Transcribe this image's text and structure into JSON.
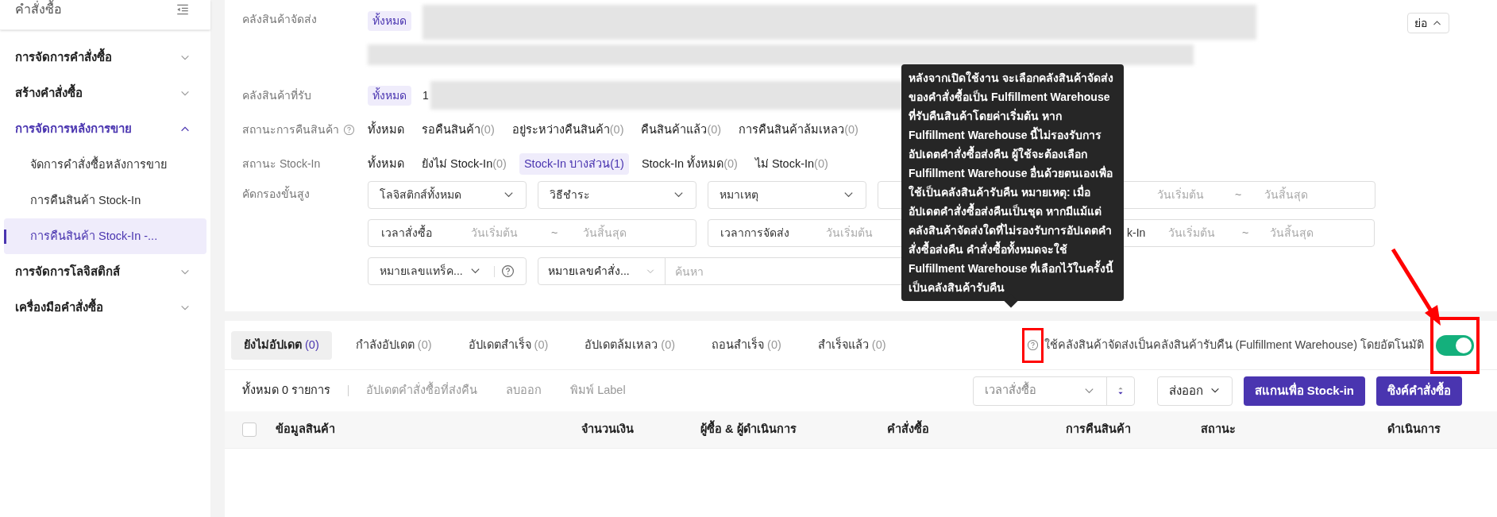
{
  "sidebar": {
    "title": "คำสั่งซื้อ",
    "items": [
      {
        "label": "การจัดการคำสั่งซื้อ",
        "expanded": false,
        "active": false
      },
      {
        "label": "สร้างคำสั่งซื้อ",
        "expanded": false,
        "active": false
      },
      {
        "label": "การจัดการหลังการขาย",
        "expanded": true,
        "active": true,
        "children": [
          {
            "label": "จัดการคำสั่งซื้อหลังการขาย",
            "selected": false
          },
          {
            "label": "การคืนสินค้า Stock-In",
            "selected": false
          },
          {
            "label": "การคืนสินค้า Stock-In -...",
            "selected": true
          }
        ]
      },
      {
        "label": "การจัดการโลจิสติกส์",
        "expanded": false,
        "active": false
      },
      {
        "label": "เครื่องมือคำสั่งซื้อ",
        "expanded": false,
        "active": false
      }
    ]
  },
  "filters": {
    "collapse_button": "ย่อ",
    "shipping_warehouse": {
      "label": "คลังสินค้าจัดส่ง",
      "all": "ทั้งหมด"
    },
    "receiving_warehouse": {
      "label": "คลังสินค้าที่รับ",
      "all": "ทั้งหมด",
      "first": "1"
    },
    "status_rows": [
      {
        "label": "สถานะการคืนสินค้า",
        "help": true,
        "options": [
          {
            "label": "ทั้งหมด",
            "selected": false
          },
          {
            "label": "รอคืนสินค้า",
            "count": "(0)",
            "selected": false
          },
          {
            "label": "อยู่ระหว่างคืนสินค้า",
            "count": "(0)",
            "selected": false
          },
          {
            "label": "คืนสินค้าแล้ว",
            "count": "(0)",
            "selected": false
          },
          {
            "label": "การคืนสินค้าล้มเหลว",
            "count": "(0)",
            "selected": false
          }
        ]
      },
      {
        "label": "สถานะ Stock-In",
        "options": [
          {
            "label": "ทั้งหมด",
            "selected": false
          },
          {
            "label": "ยังไม่ Stock-In",
            "count": "(0)",
            "selected": false
          },
          {
            "label": "Stock-In บางส่วน",
            "count": "(1)",
            "selected": true
          },
          {
            "label": "Stock-In ทั้งหมด",
            "count": "(0)",
            "selected": false
          },
          {
            "label": "ไม่ Stock-In",
            "count": "(0)",
            "selected": false
          }
        ]
      }
    ],
    "advanced_label": "คัดกรองขั้นสูง",
    "fields": [
      {
        "kind": "select",
        "text": "โลจิสติกส์ทั้งหมด"
      },
      {
        "kind": "select",
        "text": "วิธีชำระ"
      },
      {
        "kind": "select",
        "text": "หมาเหตุ"
      },
      {
        "kind": "blank"
      },
      {
        "kind": "range",
        "start": "วันเริ่มต้น",
        "sep": "~",
        "end": "วันสิ้นสุด"
      },
      {
        "kind": "range",
        "label": "เวลาสั่งซื้อ",
        "start": "วันเริ่มต้น",
        "sep": "~",
        "end": "วันสิ้นสุด"
      },
      {
        "kind": "range",
        "label": "เวลาการจัดส่ง",
        "start": "วันเริ่มต้น"
      },
      {
        "kind": "range",
        "label": "k-In",
        "start": "วันเริ่มต้น",
        "sep": "~",
        "end": "วันสิ้นสุด"
      },
      {
        "kind": "select_help",
        "text": "หมายเลขแทร็ค..."
      },
      {
        "kind": "search",
        "text": "หมายเลขคำสั่ง...",
        "placeholder": "ค้นหา"
      }
    ]
  },
  "tooltip": "หลังจากเปิดใช้งาน จะเลือกคลังสินค้าจัดส่งของคำสั่งซื้อเป็น Fulfillment Warehouse ที่รับคืนสินค้าโดยค่าเริ่มต้น หาก Fulfillment Warehouse นี้ไม่รองรับการอัปเดตคำสั่งซื้อส่งคืน ผู้ใช้จะต้องเลือก Fulfillment Warehouse อื่นด้วยตนเองเพื่อใช้เป็นคลังสินค้ารับคืน หมายเหตุ: เมื่ออัปเดตคำสั่งซื้อส่งคืนเป็นชุด หากมีแม้แต่คลังสินค้าจัดส่งใดที่ไม่รองรับการอัปเดตคำสั่งซื้อส่งคืน คำสั่งซื้อทั้งหมดจะใช้ Fulfillment Warehouse ที่เลือกไว้ในครั้งนี้เป็นคลังสินค้ารับคืน",
  "tabs": [
    {
      "label": "ยังไม่อัปเดต",
      "count": "(0)",
      "selected": true
    },
    {
      "label": "กำลังอัปเดต",
      "count": "(0)",
      "selected": false
    },
    {
      "label": "อัปเดตสำเร็จ",
      "count": "(0)",
      "selected": false
    },
    {
      "label": "อัปเดตล้มเหลว",
      "count": "(0)",
      "selected": false
    },
    {
      "label": "ถอนสำเร็จ",
      "count": "(0)",
      "selected": false
    },
    {
      "label": "สำเร็จแล้ว",
      "count": "(0)",
      "selected": false
    }
  ],
  "auto_fulfillment": {
    "label": "ใช้คลังสินค้าจัดส่งเป็นคลังสินค้ารับคืน (Fulfillment Warehouse) โดยอัตโนมัติ",
    "on": true
  },
  "toolbar": {
    "total": "ทั้งหมด 0 รายการ",
    "actions": [
      "อัปเดตคำสั่งซื้อที่ส่งคืน",
      "ลบออก",
      "พิมพ์ Label"
    ],
    "sort": "เวลาสั่งซื้อ",
    "export": "ส่งออก",
    "buttons": [
      "สแกนเพื่อ Stock-in",
      "ซิงค์คำสั่งซื้อ"
    ]
  },
  "table": {
    "select_all_checked": false,
    "columns": [
      "ข้อมูลสินค้า",
      "จำนวนเงิน",
      "ผู้ซื้อ & ผู้ดำเนินการ",
      "คำสั่งซื้อ",
      "การคืนสินค้า",
      "สถานะ",
      "ดำเนินการ"
    ]
  }
}
